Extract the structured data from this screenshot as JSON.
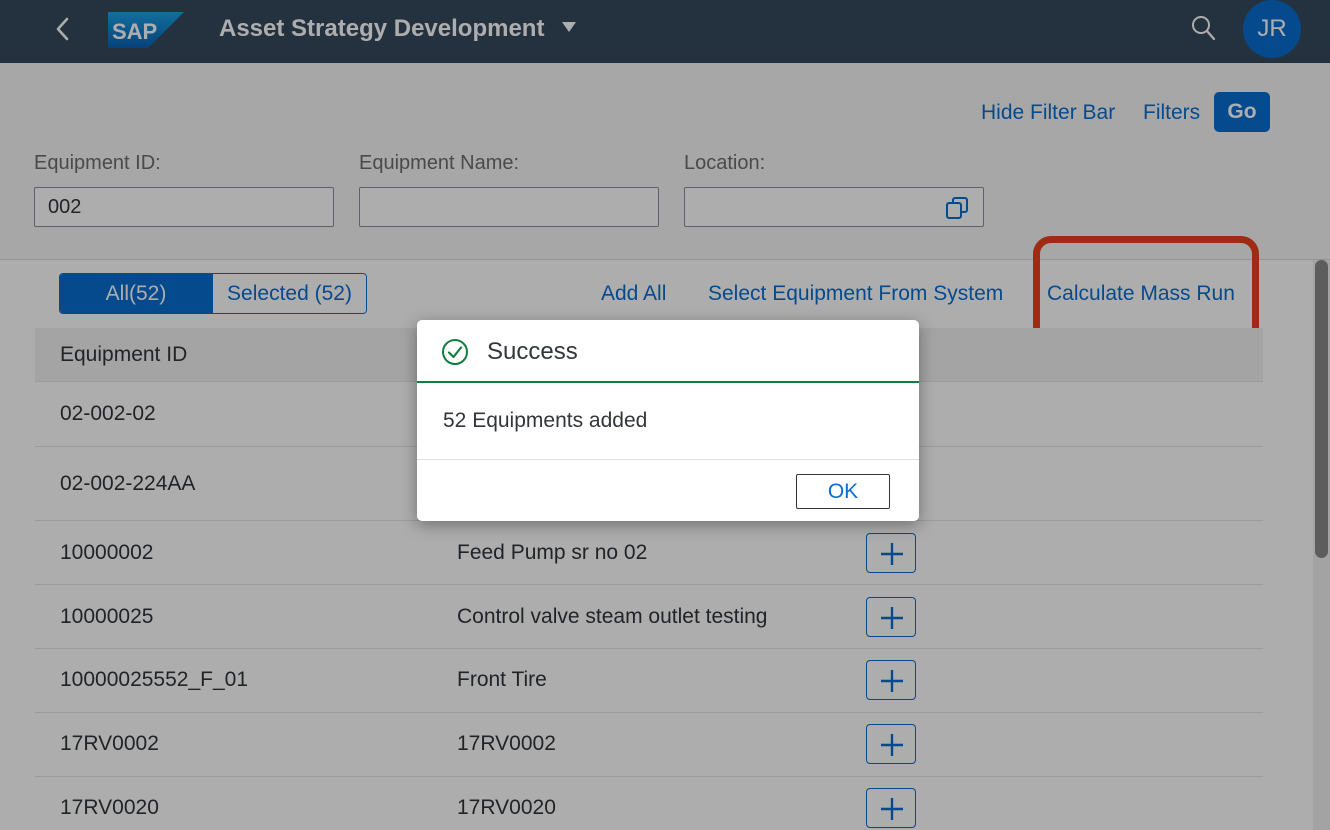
{
  "shell": {
    "title": "Asset Strategy Development",
    "avatar_initials": "JR",
    "icons": [
      "back-icon",
      "sap-logo",
      "dropdown-caret-icon",
      "search-icon"
    ],
    "colors": {
      "shell_bg": "#354a5f",
      "accent": "#0a6ed1",
      "success": "#107e3e",
      "highlight": "#e8421b"
    }
  },
  "filterbar": {
    "hide_filter_bar": "Hide Filter Bar",
    "filters": "Filters",
    "go": "Go",
    "fields": [
      {
        "label": "Equipment ID:",
        "value": "002",
        "placeholder": ""
      },
      {
        "label": "Equipment Name:",
        "value": "",
        "placeholder": ""
      },
      {
        "label": "Location:",
        "value": "",
        "placeholder": "",
        "icon": "value-help-icon"
      }
    ]
  },
  "toolbar": {
    "tab_all": "All(52)",
    "tab_selected": "Selected (52)",
    "add_all": "Add All",
    "select_equipment": "Select Equipment From System",
    "calculate_mass_run": "Calculate Mass Run"
  },
  "table": {
    "header_equipment_id": "Equipment ID",
    "rows": [
      {
        "id": "02-002-02",
        "name": ""
      },
      {
        "id": "02-002-224AA",
        "name": ""
      },
      {
        "id": "10000002",
        "name": "Feed Pump sr no 02"
      },
      {
        "id": "10000025",
        "name": "Control valve steam outlet testing"
      },
      {
        "id": "10000025552_F_01",
        "name": "Front Tire"
      },
      {
        "id": "17RV0002",
        "name": "17RV0002"
      },
      {
        "id": "17RV0020",
        "name": "17RV0020"
      }
    ],
    "row_action_icon": "plus-icon"
  },
  "dialog": {
    "title": "Success",
    "icon": "success-check-icon",
    "message": "52 Equipments added",
    "ok_button": "OK"
  }
}
